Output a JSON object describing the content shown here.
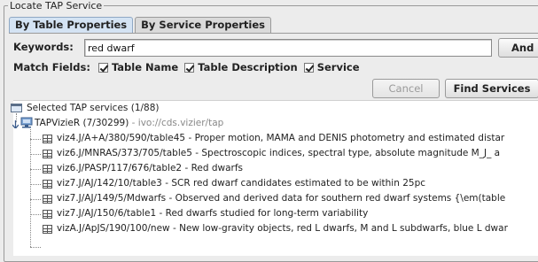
{
  "panel": {
    "title": "Locate TAP Service"
  },
  "tabs": [
    {
      "label": "By Table Properties",
      "active": true
    },
    {
      "label": "By Service Properties",
      "active": false
    }
  ],
  "search": {
    "keywords_label": "Keywords:",
    "keywords_value": "red dwarf",
    "and_label": "And",
    "match_label": "Match Fields:",
    "fields": [
      {
        "label": "Table Name",
        "checked": true
      },
      {
        "label": "Table Description",
        "checked": true
      },
      {
        "label": "Service",
        "checked": true
      }
    ],
    "cancel_label": "Cancel",
    "find_label": "Find Services"
  },
  "tree": {
    "root_label": "Selected TAP services (1/88)",
    "service": {
      "name": "TAPVizieR (7/30299)",
      "separator": " - ",
      "id": "ivo://cds.vizier/tap"
    },
    "tables": [
      "viz4.J/A+A/380/590/table45 - Proper motion, MAMA and DENIS photometry and estimated distar",
      "viz6.J/MNRAS/373/705/table5 - Spectroscopic indices, spectral type, absolute magnitude M_J_ a",
      "viz6.J/PASP/117/676/table2 - Red dwarfs",
      "viz7.J/AJ/142/10/table3 - SCR red dwarf candidates estimated to be within 25pc",
      "viz7.J/AJ/149/5/Mdwarfs - Observed and derived data for southern red dwarf systems {\\em(table",
      "viz7.J/AJ/150/6/table1 - Red dwarfs studied for long-term variability",
      "vizA.J/ApJS/190/100/new - New low-gravity objects, red L dwarfs, M and L subdwarfs, blue L dwar"
    ]
  }
}
